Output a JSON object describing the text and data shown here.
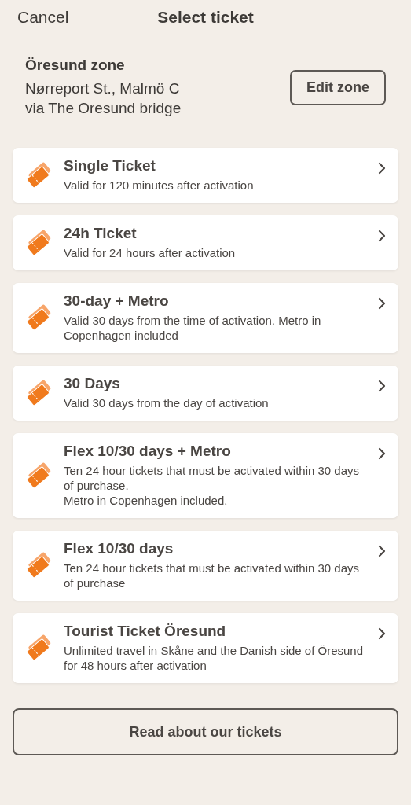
{
  "nav": {
    "cancel": "Cancel",
    "title": "Select ticket"
  },
  "zone": {
    "name": "Öresund zone",
    "route": "Nørreport St., Malmö C",
    "via": "via The Oresund bridge",
    "edit_button": "Edit zone"
  },
  "tickets": [
    {
      "title": "Single Ticket",
      "description": "Valid for 120 minutes after activation"
    },
    {
      "title": "24h Ticket",
      "description": "Valid for 24 hours after activation"
    },
    {
      "title": "30-day + Metro",
      "description": "Valid 30 days from the time of activation. Metro in Copenhagen included"
    },
    {
      "title": "30 Days",
      "description": "Valid 30 days from the day of activation"
    },
    {
      "title": "Flex 10/30 days + Metro",
      "description": "Ten 24 hour tickets that must be activated within 30 days of purchase.\nMetro in Copenhagen included."
    },
    {
      "title": "Flex 10/30 days",
      "description": "Ten 24 hour tickets that must be activated within 30 days of purchase"
    },
    {
      "title": "Tourist Ticket Öresund",
      "description": "Unlimited travel in Skåne and the Danish side of Öresund for 48 hours after activation"
    }
  ],
  "footer_button": "Read about our tickets"
}
